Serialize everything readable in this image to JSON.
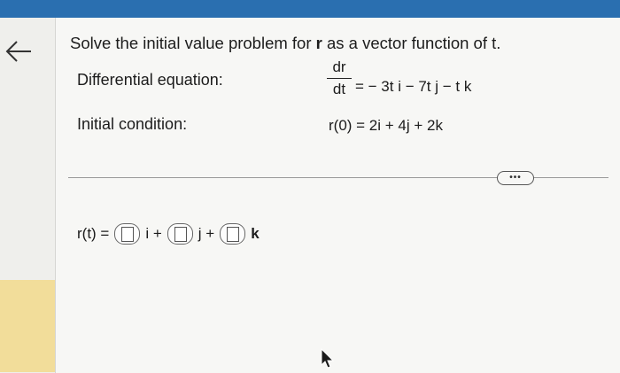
{
  "question": {
    "prefix": "Solve the initial value problem for",
    "bold_var": "r",
    "suffix": "as a vector function of t."
  },
  "differential_equation": {
    "label": "Differential equation:",
    "numerator": "dr",
    "denominator": "dt",
    "rhs": "= − 3t i − 7t j − t k"
  },
  "initial_condition": {
    "label": "Initial condition:",
    "value": "r(0) = 2i + 4j + 2k"
  },
  "more_button": {
    "label": "•••"
  },
  "answer": {
    "lhs": "r(t) =",
    "unit_i": "i +",
    "unit_j": "j +",
    "unit_k": "k"
  }
}
